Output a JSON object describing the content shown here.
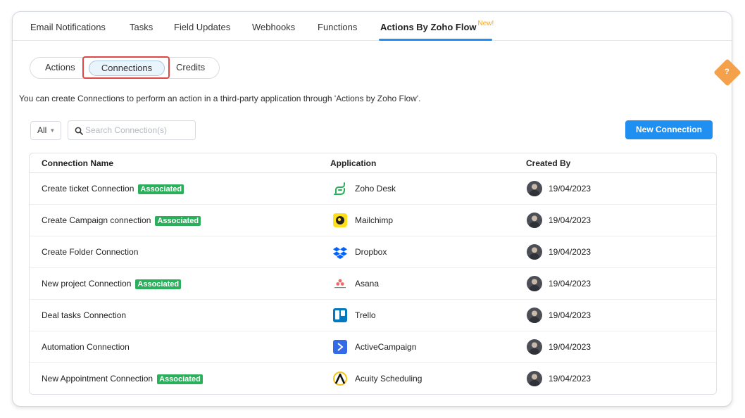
{
  "tabs": [
    {
      "label": "Email Notifications",
      "active": false
    },
    {
      "label": "Tasks",
      "active": false
    },
    {
      "label": "Field Updates",
      "active": false
    },
    {
      "label": "Webhooks",
      "active": false
    },
    {
      "label": "Functions",
      "active": false
    },
    {
      "label": "Actions By Zoho Flow",
      "active": true,
      "badge": "New!"
    }
  ],
  "subnav": {
    "actions": "Actions",
    "connections": "Connections",
    "credits": "Credits",
    "selected": "Connections"
  },
  "info_text": "You can create Connections to perform an action in a third-party application through 'Actions by Zoho Flow'.",
  "filter": {
    "value": "All"
  },
  "search": {
    "placeholder": "Search Connection(s)"
  },
  "new_button": "New Connection",
  "table": {
    "headers": {
      "name": "Connection Name",
      "application": "Application",
      "created_by": "Created By"
    },
    "rows": [
      {
        "name": "Create ticket Connection",
        "badge": "Associated",
        "app": "Zoho Desk",
        "app_icon": "zoho-desk-icon",
        "date": "19/04/2023"
      },
      {
        "name": "Create Campaign connection",
        "badge": "Associated",
        "app": "Mailchimp",
        "app_icon": "mailchimp-icon",
        "date": "19/04/2023"
      },
      {
        "name": "Create Folder Connection",
        "badge": "",
        "app": "Dropbox",
        "app_icon": "dropbox-icon",
        "date": "19/04/2023"
      },
      {
        "name": "New project Connection",
        "badge": "Associated",
        "app": "Asana",
        "app_icon": "asana-icon",
        "date": "19/04/2023"
      },
      {
        "name": "Deal tasks Connection",
        "badge": "",
        "app": "Trello",
        "app_icon": "trello-icon",
        "date": "19/04/2023"
      },
      {
        "name": "Automation Connection",
        "badge": "",
        "app": "ActiveCampaign",
        "app_icon": "activecampaign-icon",
        "date": "19/04/2023"
      },
      {
        "name": "New Appointment Connection",
        "badge": "Associated",
        "app": "Acuity Scheduling",
        "app_icon": "acuity-scheduling-icon",
        "date": "19/04/2023"
      }
    ]
  },
  "help_label": "?",
  "colors": {
    "accent": "#1f8ff2",
    "associated": "#2ab05a",
    "new_badge": "#f5a623",
    "highlight": "#e04646"
  }
}
